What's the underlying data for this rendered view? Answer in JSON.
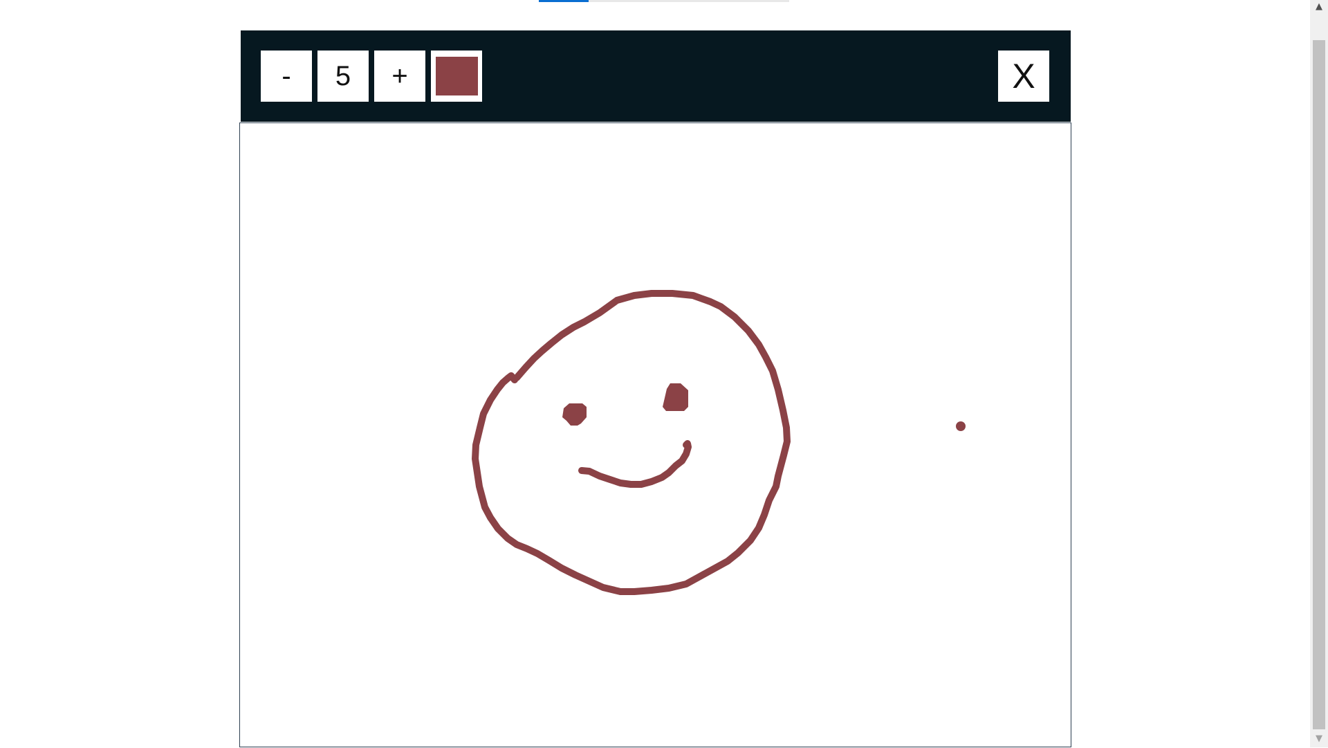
{
  "top_progress": {
    "fill_fraction": 0.2
  },
  "toolbar": {
    "decrease_label": "-",
    "brush_size": "5",
    "increase_label": "+",
    "brush_color": "#8b4246",
    "close_label": "X"
  },
  "canvas": {
    "stroke_color": "#8b4246",
    "background": "#ffffff"
  },
  "scrollbar": {
    "up_arrow": "▲",
    "down_arrow": "▼"
  },
  "colors": {
    "toolbar_bg": "#061820",
    "accent": "#0a6ed1"
  }
}
